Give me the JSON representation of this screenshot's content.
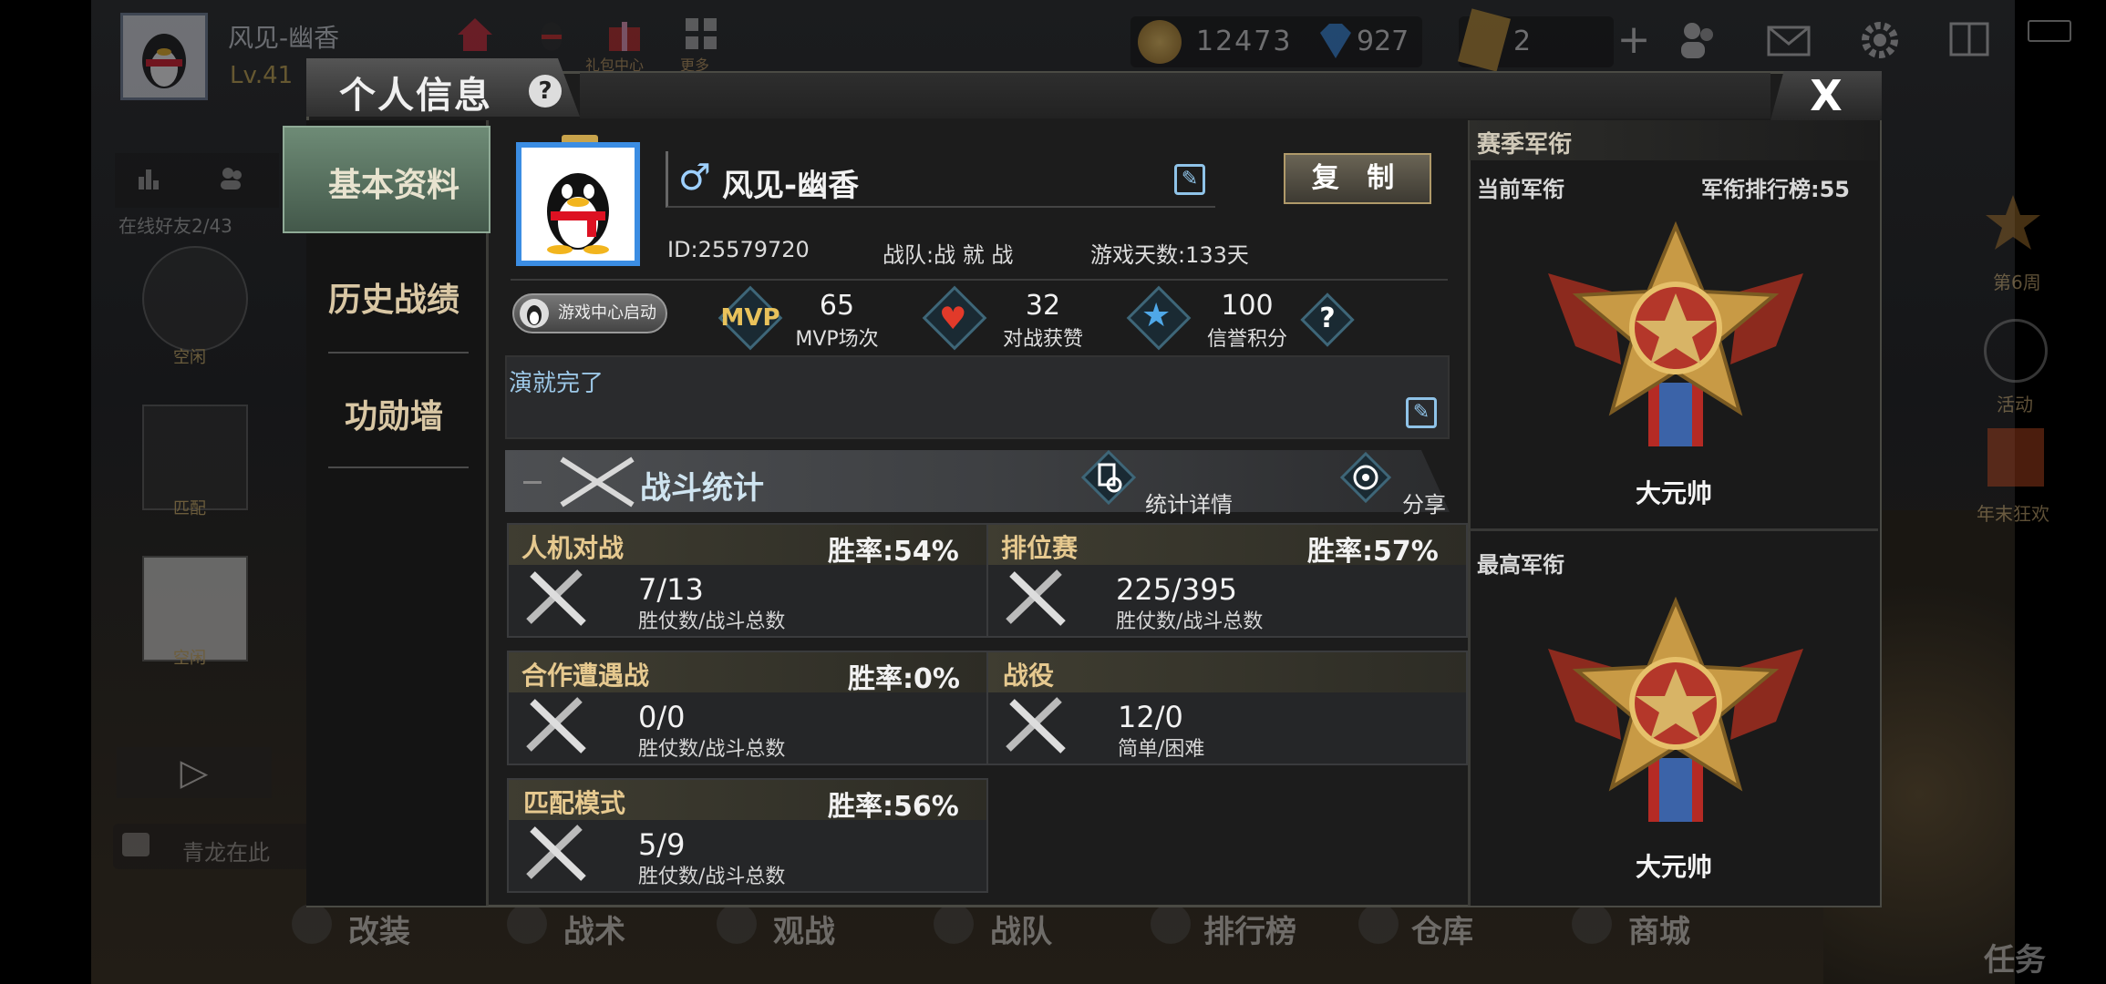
{
  "topbar": {
    "player_name": "风见-幽香",
    "level": "Lv.41",
    "icon_labels": [
      "礼包中心",
      "更多"
    ],
    "coins": "12473",
    "gems": "927",
    "tickets": "2"
  },
  "left_panel": {
    "online_friends": "在线好友2/43",
    "friend_labels": [
      "空闲",
      "匹配",
      "空闲"
    ],
    "chat_text": "青龙在此"
  },
  "modal": {
    "title": "个人信息",
    "help": "?",
    "close": "X"
  },
  "sidenav": {
    "items": [
      {
        "label": "基本资料",
        "active": true
      },
      {
        "label": "历史战绩",
        "active": false
      },
      {
        "label": "功勋墙",
        "active": false
      }
    ]
  },
  "profile": {
    "gender_symbol": "♂",
    "name": "风见-幽香",
    "copy_label": "复 制",
    "id_text": "ID:25579720",
    "team_text": "战队:战 就 战",
    "days_text": "游戏天数:133天",
    "game_center_label": "游戏中心启动",
    "signature": "演就完了"
  },
  "stats": [
    {
      "icon": "mvp-badge-icon",
      "icon_text": "MVP",
      "value": "65",
      "label": "MVP场次"
    },
    {
      "icon": "heart-icon",
      "value": "32",
      "label": "对战获赞"
    },
    {
      "icon": "star-icon",
      "value": "100",
      "label": "信誉积分"
    }
  ],
  "stats_help": "?",
  "battle_stats": {
    "title": "战斗统计",
    "detail_label": "统计详情",
    "share_label": "分享"
  },
  "modes": [
    {
      "name": "人机对战",
      "rate": "胜率:54%",
      "value": "7/13",
      "sub": "胜仗数/战斗总数"
    },
    {
      "name": "排位赛",
      "rate": "胜率:57%",
      "value": "225/395",
      "sub": "胜仗数/战斗总数"
    },
    {
      "name": "合作遭遇战",
      "rate": "胜率:0%",
      "value": "0/0",
      "sub": "胜仗数/战斗总数"
    },
    {
      "name": "战役",
      "rate": "",
      "value": "12/0",
      "sub": "简单/困难"
    },
    {
      "name": "匹配模式",
      "rate": "胜率:56%",
      "value": "5/9",
      "sub": "胜仗数/战斗总数"
    }
  ],
  "rank_panel": {
    "title": "赛季军衔",
    "current_label": "当前军衔",
    "ranking_text": "军衔排行榜:55",
    "current_rank": "大元帅",
    "best_label": "最高军衔",
    "best_rank": "大元帅"
  },
  "right_hud": {
    "items": [
      "第6周",
      "活动",
      "年末狂欢"
    ],
    "task_label": "任务"
  },
  "bottom_nav": [
    "改装",
    "战术",
    "观战",
    "战队",
    "排行榜",
    "仓库",
    "商城"
  ],
  "colors": {
    "accent_gold": "#e6c98f",
    "nav_active": "#5b7563",
    "link_blue": "#9cc7e6"
  }
}
